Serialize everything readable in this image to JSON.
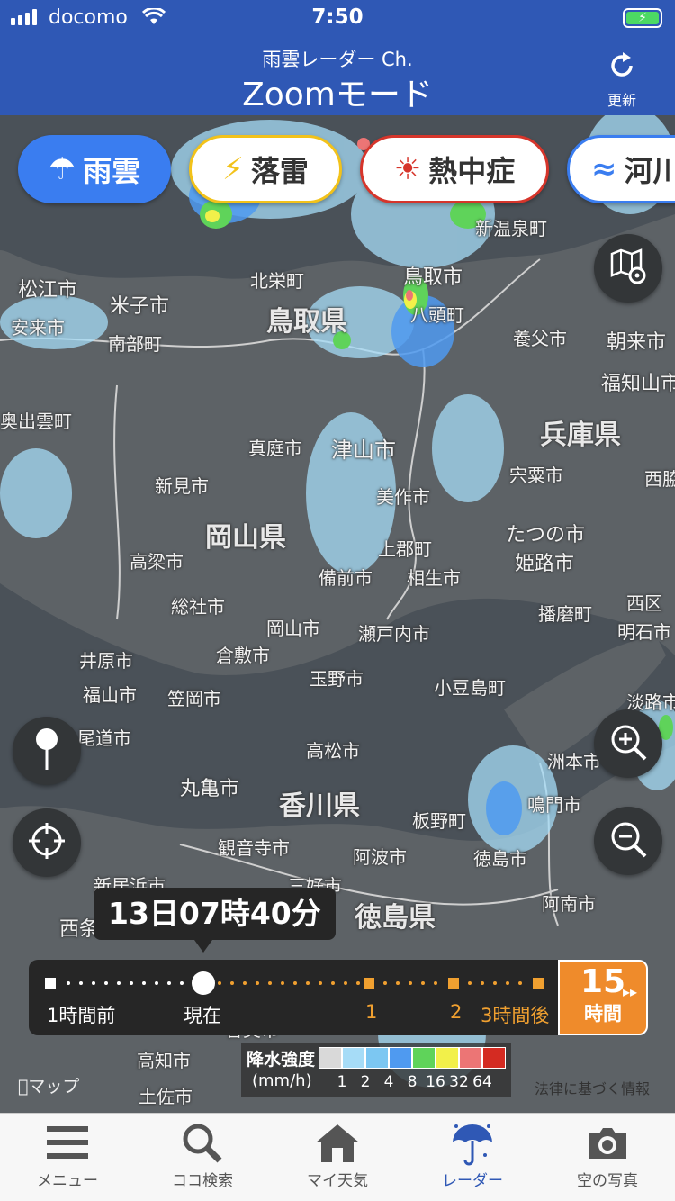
{
  "status_bar": {
    "carrier": "docomo",
    "time": "7:50"
  },
  "header": {
    "subtitle": "雨雲レーダー Ch.",
    "title": "Zoomモード",
    "refresh_label": "更新"
  },
  "layers": [
    {
      "label": "雨雲",
      "icon": "rain-cloud-icon"
    },
    {
      "label": "落雷",
      "icon": "lightning-icon"
    },
    {
      "label": "熱中症",
      "icon": "sun-icon"
    },
    {
      "label": "河川",
      "icon": "river-icon"
    }
  ],
  "places": {
    "p1": "新温泉町",
    "p2": "鳥取市",
    "p3": "北栄町",
    "p4": "松江市",
    "p5": "米子市",
    "p6": "鳥取県",
    "p7": "八頭町",
    "p8": "安来市",
    "p9": "南部町",
    "p10": "養父市",
    "p11": "朝来市",
    "p12": "福知山市",
    "p13": "奥出雲町",
    "p14": "兵庫県",
    "p15": "真庭市",
    "p16": "津山市",
    "p17": "宍粟市",
    "p18": "新見市",
    "p19": "美作市",
    "p20": "西脇",
    "p21": "岡山県",
    "p22": "たつの市",
    "p23": "高梁市",
    "p24": "上郡町",
    "p25": "姫路市",
    "p26": "備前市",
    "p27": "相生市",
    "p28": "総社市",
    "p29": "西区",
    "p30": "播磨町",
    "p31": "岡山市",
    "p32": "瀬戸内市",
    "p33": "明石市",
    "p34": "倉敷市",
    "p35": "井原市",
    "p36": "小豆島町",
    "p37": "福山市",
    "p38": "笠岡市",
    "p39": "玉野市",
    "p40": "淡路市",
    "p41": "尾道市",
    "p42": "高松市",
    "p43": "洲本市",
    "p44": "丸亀市",
    "p45": "香川県",
    "p46": "鳴門市",
    "p47": "観音寺市",
    "p48": "阿波市",
    "p49": "板野町",
    "p50": "徳島市",
    "p51": "新居浜市",
    "p52": "三好市",
    "p53": "阿南市",
    "p54": "西条",
    "p55": "徳島県",
    "p56": "香美市",
    "p57": "高知市",
    "p58": "土佐市"
  },
  "timeline": {
    "current_time": "13日07時40分",
    "start_label": "1時間前",
    "now_label": "現在",
    "mark_1": "1",
    "mark_2": "2",
    "end_label": "3時間後",
    "play_number": "15",
    "play_unit": "時間",
    "play_arrow": "▸▸"
  },
  "legend": {
    "title": "降水強度",
    "unit": "(mm/h)",
    "values": [
      "1",
      "2",
      "4",
      "8",
      "16",
      "32",
      "64"
    ],
    "colors": [
      "#d9d9d9",
      "#a6dcf7",
      "#7cc7f2",
      "#4f9af0",
      "#5fd35a",
      "#f2f04a",
      "#ec7575",
      "#d42b22"
    ]
  },
  "map_credit": "マップ",
  "legal_link": "法律に基づく情報",
  "tabs": [
    {
      "label": "メニュー",
      "icon": "menu-icon"
    },
    {
      "label": "ココ検索",
      "icon": "search-icon"
    },
    {
      "label": "マイ天気",
      "icon": "home-icon"
    },
    {
      "label": "レーダー",
      "icon": "umbrella-icon"
    },
    {
      "label": "空の写真",
      "icon": "camera-icon"
    }
  ],
  "colors": {
    "header_bg": "#2f58b5",
    "active_tab": "#2f58b5",
    "play_orange": "#ef8b2b",
    "land": "#5d6266",
    "sea": "#4a5158"
  }
}
